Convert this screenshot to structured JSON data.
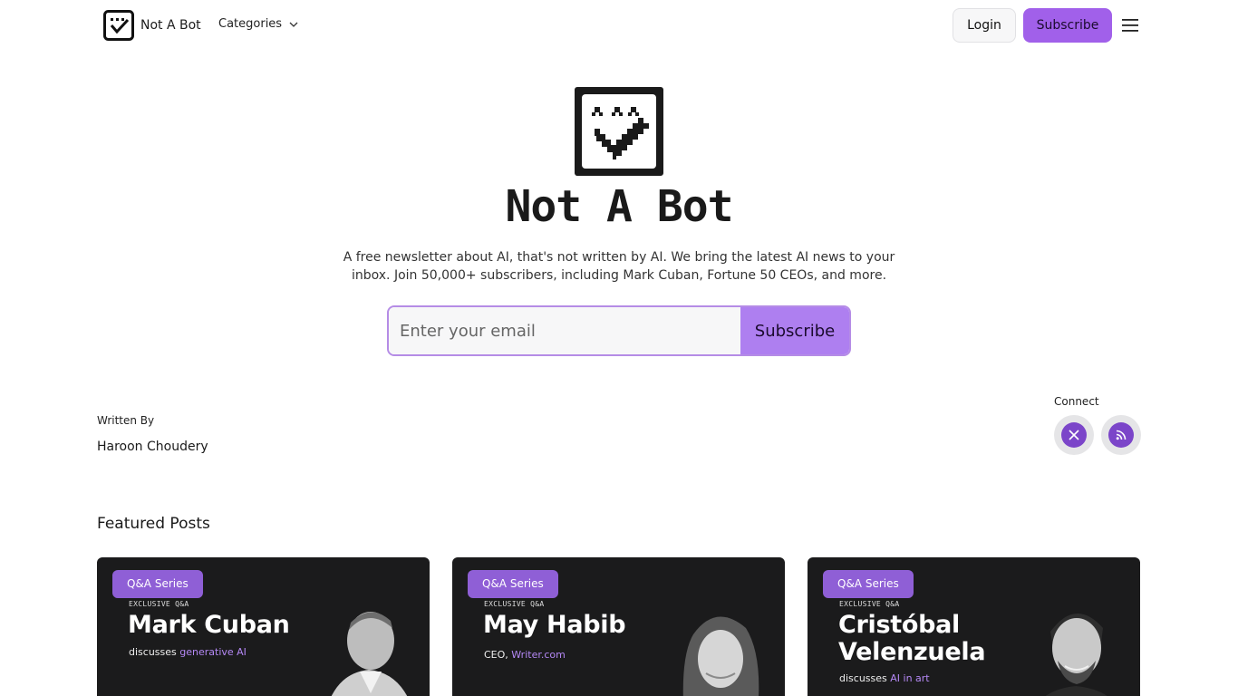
{
  "header": {
    "brand_name": "Not A Bot",
    "categories_label": "Categories",
    "login_label": "Login",
    "subscribe_label": "Subscribe"
  },
  "hero": {
    "title": "Not A Bot",
    "description": "A free newsletter about AI, that's not written by AI. We bring the latest AI news to your inbox. Join 50,000+ subscribers, including Mark Cuban, Fortune 50 CEOs, and more.",
    "email_placeholder": "Enter your email",
    "subscribe_label": "Subscribe"
  },
  "author": {
    "written_by_label": "Written By",
    "name": "Haroon Choudery"
  },
  "connect": {
    "label": "Connect",
    "icons": [
      "x-icon",
      "rss-icon"
    ]
  },
  "featured": {
    "title": "Featured Posts",
    "cards": [
      {
        "badge": "Q&A Series",
        "kicker": "EXCLUSIVE Q&A",
        "name": "Mark Cuban",
        "sub_prefix": "discusses ",
        "sub_accent": "generative AI"
      },
      {
        "badge": "Q&A Series",
        "kicker": "EXCLUSIVE Q&A",
        "name": "May Habib",
        "sub_prefix": "CEO, ",
        "sub_accent": "Writer.com"
      },
      {
        "badge": "Q&A Series",
        "kicker": "EXCLUSIVE Q&A",
        "name": "Cristóbal\nVelenzuela",
        "sub_prefix": "discusses ",
        "sub_accent": "AI in art"
      }
    ]
  },
  "colors": {
    "accent": "#a160ea",
    "accent_dark": "#7b45c9",
    "card_bg": "#1b1b1c"
  }
}
